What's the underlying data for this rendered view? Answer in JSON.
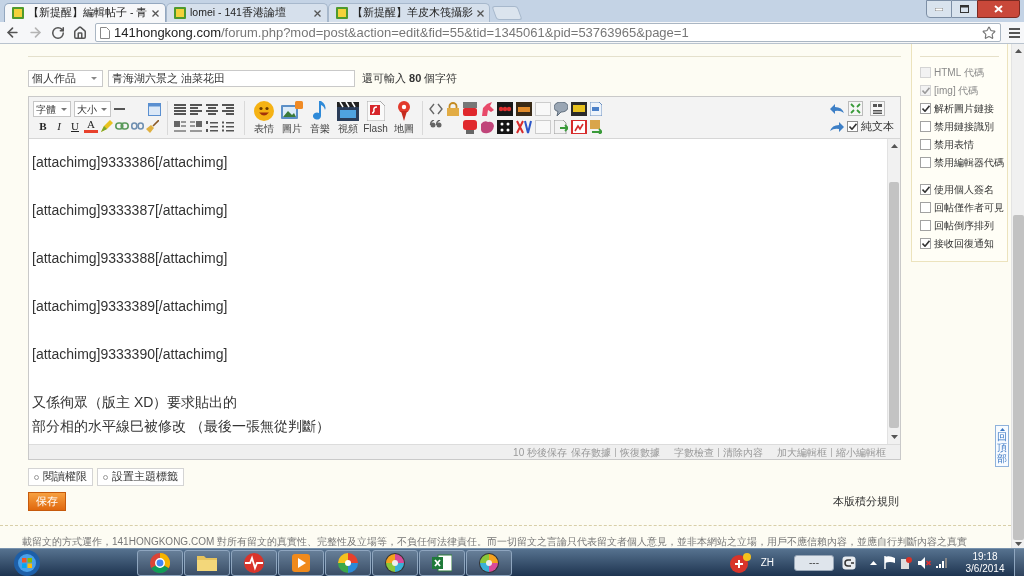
{
  "browser": {
    "tabs": [
      {
        "title": "【新提醒】編輯帖子 - 青",
        "selected": true
      },
      {
        "title": "lomei - 141香港論壇",
        "selected": false
      },
      {
        "title": "【新提醒】羊皮木筏攝影",
        "selected": false
      }
    ],
    "address": {
      "domain": "141hongkong.com",
      "path": "/forum.php?mod=post&action=edit&fid=55&tid=1345061&pid=53763965&page=1"
    }
  },
  "post_form": {
    "category": "個人作品",
    "title": "青海湖六景之 油菜花田",
    "title_hint": "還可輸入 **80** 個字符"
  },
  "toolbar": {
    "font": "字體",
    "size": "大小",
    "format_buttons": [
      "B",
      "I",
      "U",
      "A"
    ],
    "media_buttons": [
      "表情",
      "圖片",
      "音樂",
      "視頻",
      "Flash",
      "地圖"
    ],
    "plain_text": {
      "label": "純文本",
      "checked": true
    }
  },
  "editor": {
    "paragraphs": [
      [
        "[attachimg]9333386[/attachimg]"
      ],
      [
        "[attachimg]9333387[/attachimg]"
      ],
      [
        "[attachimg]9333388[/attachimg]"
      ],
      [
        "[attachimg]9333389[/attachimg]"
      ],
      [
        "[attachimg]9333390[/attachimg]"
      ],
      [
        "又係徇眾（版主 XD）要求貼出的",
        "部分相的水平線巳被修改 （最後一張無從判斷）"
      ]
    ],
    "autosave_note": "10 秒後保存",
    "status_links": [
      [
        "保存數據",
        "恢復數據"
      ],
      [
        "字數檢查",
        "清除內容"
      ],
      [
        "加大編輯框",
        "縮小編輯框"
      ]
    ]
  },
  "options": {
    "groups": [
      [
        {
          "label": "HTML 代碼",
          "checked": false,
          "disabled": true
        },
        {
          "label": "[img] 代碼",
          "checked": true,
          "disabled": true
        },
        {
          "label": "解析圖片鏈接",
          "checked": true,
          "disabled": false
        },
        {
          "label": "禁用鏈接識別",
          "checked": false,
          "disabled": false
        },
        {
          "label": "禁用表情",
          "checked": false,
          "disabled": false
        },
        {
          "label": "禁用編輯器代碼",
          "checked": false,
          "disabled": false
        }
      ],
      [
        {
          "label": "使用個人簽名",
          "checked": true,
          "disabled": false
        },
        {
          "label": "回帖僅作者可見",
          "checked": false,
          "disabled": false
        },
        {
          "label": "回帖倒序排列",
          "checked": false,
          "disabled": false
        },
        {
          "label": "接收回復通知",
          "checked": true,
          "disabled": false
        }
      ]
    ]
  },
  "form_actions": {
    "extra_buttons": [
      "閱讀權限",
      "設置主題標籤"
    ],
    "save_button": "保存",
    "rules_link": "本版積分規則"
  },
  "back_to_top": "回頂部",
  "footer": {
    "disclaimer": "載留文的方式運作，141HONGKONG.COM 對所有留文的真實性、完整性及立場等，不負任何法律責任。而一切留文之言論只代表留文者個人意見，並非本網站之立場，用戶不應信賴內容，並應自行判斷內容之真實"
  },
  "taskbar": {
    "input_language": "ZH",
    "gauge_reading": "---",
    "time": "19:18",
    "date": "3/6/2014"
  }
}
